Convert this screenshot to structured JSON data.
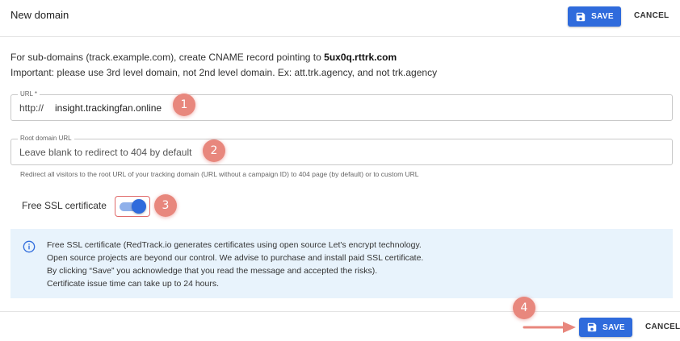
{
  "header": {
    "title": "New domain",
    "save_label": "SAVE",
    "cancel_label": "CANCEL"
  },
  "info": {
    "line1_prefix": "For sub-domains (track.example.com), create CNAME record pointing to ",
    "line1_bold": "5ux0q.rttrk.com",
    "line2": "Important: please use 3rd level domain, not 2nd level domain. Ex: att.trk.agency, and not trk.agency"
  },
  "url_field": {
    "label": "URL *",
    "prefix": "http://",
    "value": "insight.trackingfan.online"
  },
  "root_field": {
    "label": "Root domain URL",
    "placeholder": "Leave blank to redirect to 404 by default",
    "helper": "Redirect all visitors to the root URL of your tracking domain (URL without a campaign ID) to 404 page (by default) or to custom URL"
  },
  "ssl": {
    "label": "Free SSL certificate",
    "enabled": true
  },
  "notice": {
    "icon": "info-icon",
    "lines": [
      "Free SSL certificate (RedTrack.io generates certificates using open source Let's encrypt technology.",
      "Open source projects are beyond our control. We advise to purchase and install paid SSL certificate.",
      "By clicking “Save” you acknowledge that you read the message and accepted the risks).",
      "Certificate issue time can take up to 24 hours."
    ]
  },
  "footer": {
    "save_label": "SAVE",
    "cancel_label": "CANCEL"
  },
  "annotations": {
    "badges": [
      "1",
      "2",
      "3",
      "4"
    ]
  },
  "colors": {
    "primary": "#2f6bdc",
    "badge": "#e8877d",
    "notice_bg": "#e8f3fc"
  }
}
